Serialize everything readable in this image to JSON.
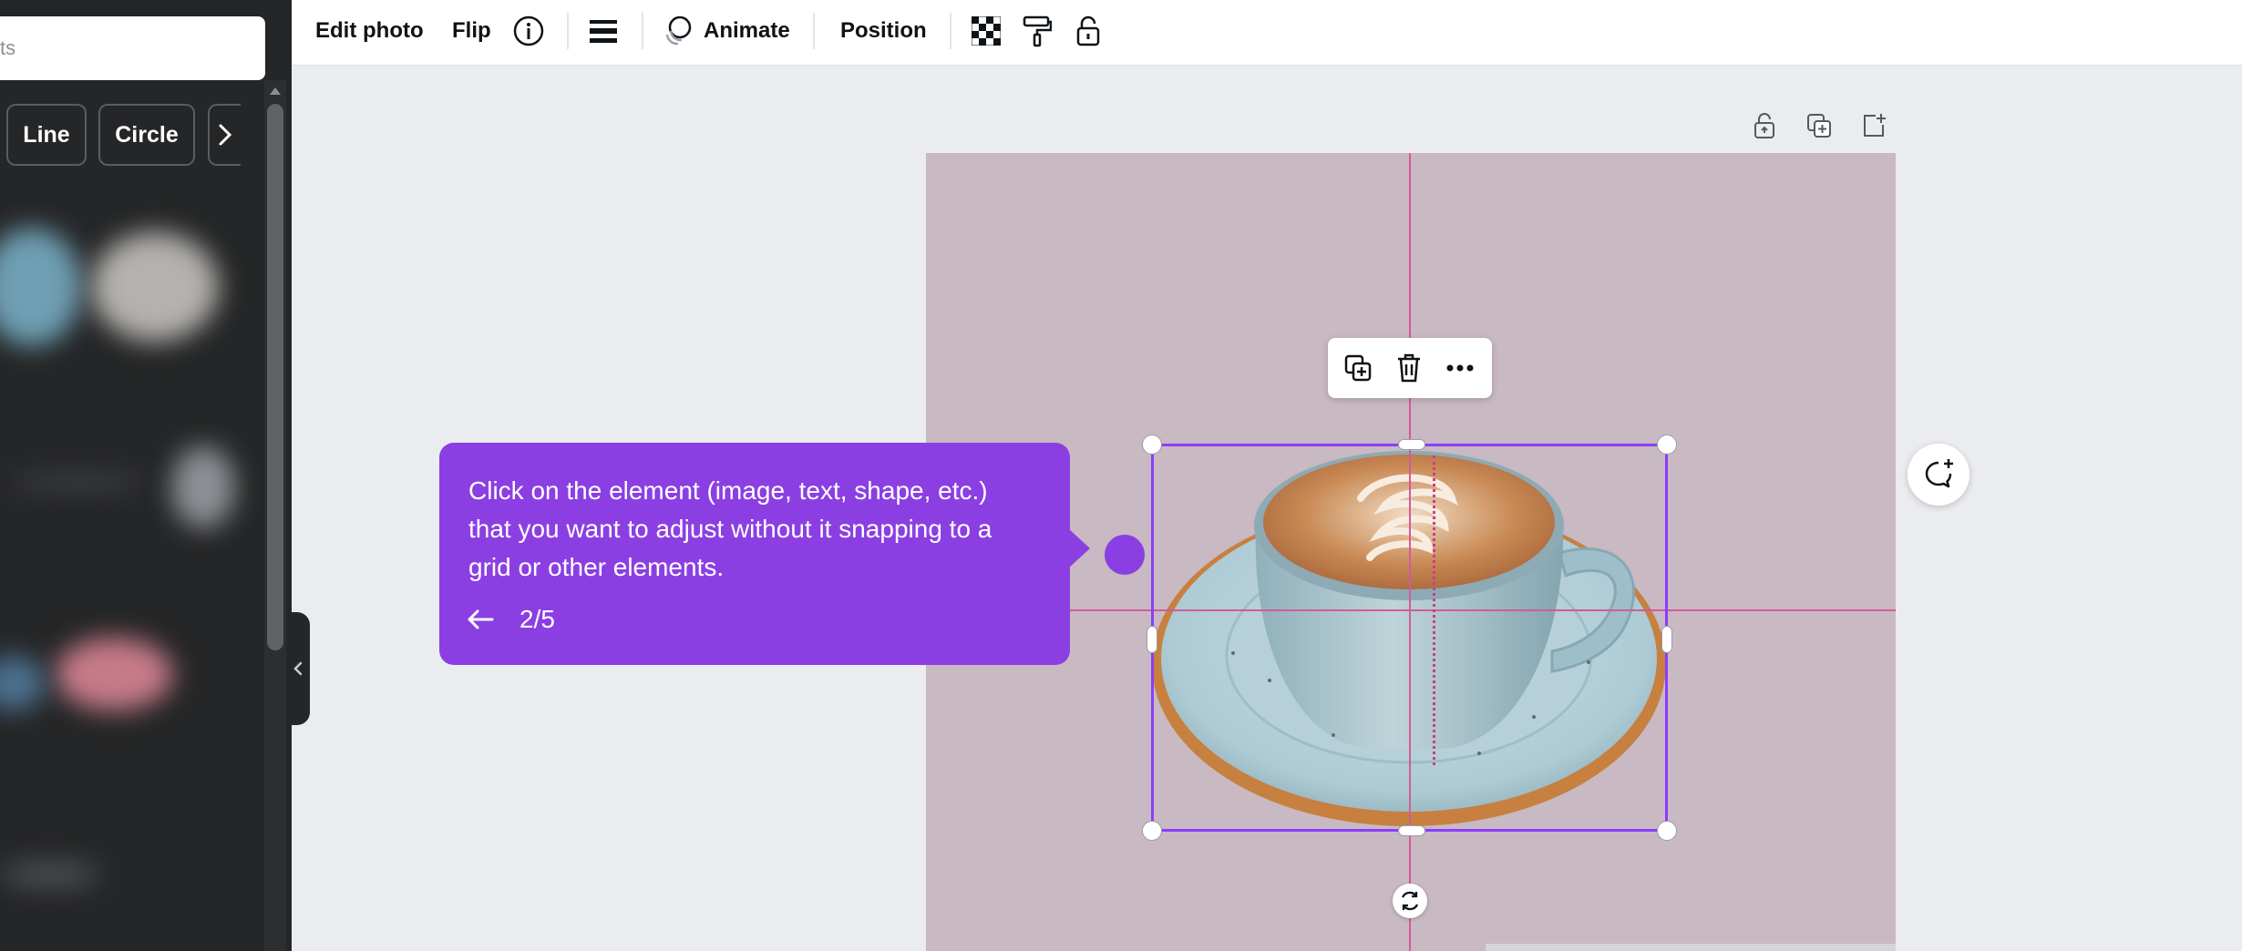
{
  "sidebar": {
    "search_placeholder": "ts",
    "chips": [
      "Line",
      "Circle"
    ]
  },
  "toolbar": {
    "edit_photo": "Edit photo",
    "flip": "Flip",
    "animate": "Animate",
    "position": "Position"
  },
  "tooltip": {
    "text": "Click on the element (image, text, shape, etc.) that you want to adjust without it snapping to a grid or other elements.",
    "step": "2/5"
  },
  "colors": {
    "accent": "#8b3dff",
    "tooltip": "#8b3fe3",
    "canvas_bg": "#c8b9c3",
    "guide": "#d45a9c",
    "panel": "#252627"
  },
  "icons": {
    "info": "info-icon",
    "lines": "line-weight-icon",
    "animate": "animate-icon",
    "transparency": "transparency-icon",
    "paint_roller": "copy-style-icon",
    "lock": "lock-icon",
    "duplicate": "duplicate-icon",
    "delete": "trash-icon",
    "more": "more-icon",
    "rotate": "rotate-icon",
    "comment": "add-comment-icon"
  }
}
